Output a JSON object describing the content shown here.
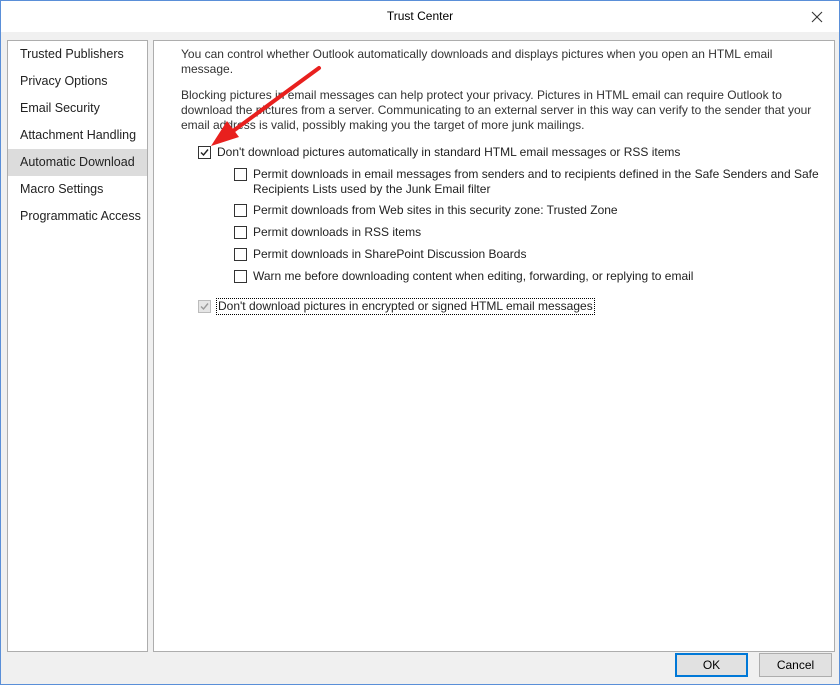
{
  "window": {
    "title": "Trust Center"
  },
  "nav": {
    "items": [
      {
        "label": "Trusted Publishers",
        "selected": false
      },
      {
        "label": "Privacy Options",
        "selected": false
      },
      {
        "label": "Email Security",
        "selected": false
      },
      {
        "label": "Attachment Handling",
        "selected": false
      },
      {
        "label": "Automatic Download",
        "selected": true
      },
      {
        "label": "Macro Settings",
        "selected": false
      },
      {
        "label": "Programmatic Access",
        "selected": false
      }
    ]
  },
  "content": {
    "intro_line1": "You can control whether Outlook automatically downloads and displays pictures when you open an HTML email",
    "intro_line2": "message.",
    "privacy_line1": "Blocking pictures in email messages can help protect your privacy. Pictures in HTML email can require Outlook to",
    "privacy_line2": "download the pictures from a server. Communicating to an external server in this way can verify to the sender that your",
    "privacy_line3": "email address is valid, possibly making you the target of more junk mailings.",
    "options": {
      "dont_download_standard": {
        "label": "Don't download pictures automatically in standard HTML email messages or RSS items",
        "checked": true
      },
      "permit_safe_senders": {
        "label_line1": "Permit downloads in email messages from senders and to recipients defined in the Safe Senders and Safe",
        "label_line2": "Recipients Lists used by the Junk Email filter",
        "checked": false
      },
      "permit_web_sites": {
        "label": "Permit downloads from Web sites in this security zone: Trusted Zone",
        "checked": false
      },
      "permit_rss": {
        "label": "Permit downloads in RSS items",
        "checked": false
      },
      "permit_sharepoint": {
        "label": "Permit downloads in SharePoint Discussion Boards",
        "checked": false
      },
      "warn_before": {
        "label": "Warn me before downloading content when editing, forwarding, or replying to email",
        "checked": false
      },
      "dont_download_encrypted": {
        "label": "Don't download pictures in encrypted or signed HTML email messages",
        "checked": true,
        "disabled": true
      }
    }
  },
  "buttons": {
    "ok": "OK",
    "cancel": "Cancel"
  },
  "annotation": {
    "arrow_color": "#e8201e"
  },
  "colors": {
    "accent": "#0078d7",
    "selected_nav": "#dcdcdc"
  }
}
